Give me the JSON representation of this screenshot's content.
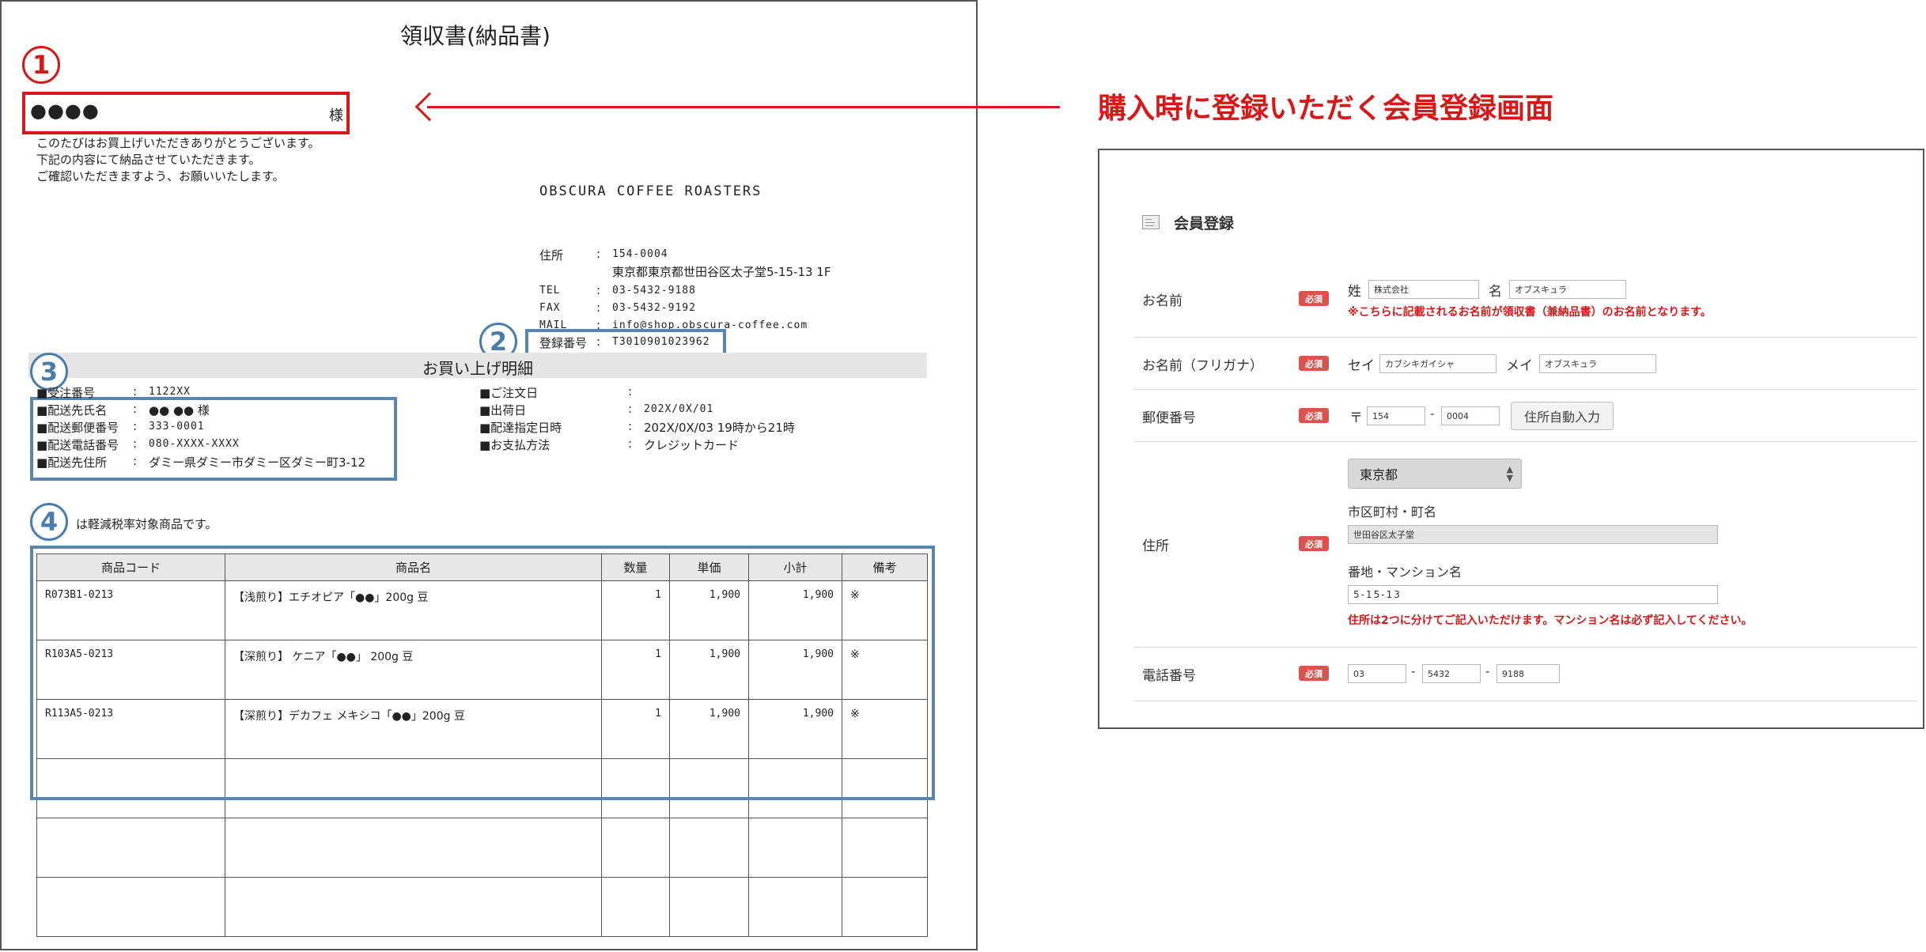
{
  "receipt": {
    "title": "領収書(納品書)",
    "badge1": "1",
    "badge2": "2",
    "badge3": "3",
    "badge4": "4",
    "recipient_name": "●●●●",
    "recipient_suffix": "様",
    "greeting": [
      "このたびはお買上げいただきありがとうございます。",
      "下記の内容にて納品させていただきます。",
      "ご確認いただきますよう、お願いいたします。"
    ],
    "shop_name": "OBSCURA COFFEE ROASTERS",
    "shop_info": [
      {
        "label": "住所",
        "sep": ":",
        "value": "154-0004"
      },
      {
        "label": "",
        "sep": "",
        "value": "東京都東京都世田谷区太子堂5-15-13 1F"
      },
      {
        "label": "TEL",
        "sep": ":",
        "value": "03-5432-9188"
      },
      {
        "label": "FAX",
        "sep": ":",
        "value": "03-5432-9192"
      },
      {
        "label": "MAIL",
        "sep": ":",
        "value": "info@shop.obscura-coffee.com"
      }
    ],
    "registration": {
      "label": "登録番号",
      "sep": ":",
      "value": "T3010901023962"
    },
    "section_title": "お買い上げ明細",
    "order_left": [
      {
        "label": "■受注番号",
        "sep": ":",
        "value": "1122XX"
      },
      {
        "label": "■配送先氏名",
        "sep": ":",
        "value": "●● ●● 様"
      },
      {
        "label": "■配送郵便番号",
        "sep": ":",
        "value": "333-0001"
      },
      {
        "label": "■配送電話番号",
        "sep": ":",
        "value": "080-XXXX-XXXX"
      },
      {
        "label": "■配送先住所",
        "sep": ":",
        "value": "ダミー県ダミー市ダミー区ダミー町3-12"
      }
    ],
    "order_right": [
      {
        "label": "■ご注文日",
        "sep": ":",
        "value": ""
      },
      {
        "label": "■出荷日",
        "sep": ":",
        "value": "202X/0X/01"
      },
      {
        "label": "■配達指定日時",
        "sep": ":",
        "value": "202X/0X/03 19時から21時"
      },
      {
        "label": "■お支払方法",
        "sep": ":",
        "value": "クレジットカード"
      }
    ],
    "reduced_tax_note": "は軽減税率対象商品です。",
    "table": {
      "headers": [
        "商品コード",
        "商品名",
        "数量",
        "単価",
        "小計",
        "備考"
      ],
      "rows": [
        [
          "R073B1-0213",
          "【浅煎り】エチオピア「●●」200g 豆",
          "1",
          "1,900",
          "1,900",
          "※"
        ],
        [
          "R103A5-0213",
          "【深煎り】 ケニア「●●」 200g 豆",
          "1",
          "1,900",
          "1,900",
          "※"
        ],
        [
          "R113A5-0213",
          "【深煎り】デカフェ メキシコ「●●」200g 豆",
          "1",
          "1,900",
          "1,900",
          "※"
        ],
        [
          "",
          "",
          "",
          "",
          "",
          ""
        ],
        [
          "",
          "",
          "",
          "",
          "",
          ""
        ],
        [
          "",
          "",
          "",
          "",
          "",
          ""
        ]
      ]
    }
  },
  "heading": "購入時に登録いただく会員登録画面",
  "form": {
    "title": "会員登録",
    "required": "必須",
    "name": {
      "label": "お名前",
      "sei_label": "姓",
      "sei_value": "株式会社",
      "mei_label": "名",
      "mei_value": "オブスキュラ",
      "note": "※こちらに記載されるお名前が領収書（兼納品書）のお名前となります。"
    },
    "kana": {
      "label": "お名前（フリガナ）",
      "sei_label": "セイ",
      "sei_value": "カブシキガイシャ",
      "mei_label": "メイ",
      "mei_value": "オブスキュラ"
    },
    "postal": {
      "label": "郵便番号",
      "mark": "〒",
      "part1": "154",
      "dash": "-",
      "part2": "0004",
      "button": "住所自動入力"
    },
    "address": {
      "label": "住所",
      "prefecture": "東京都",
      "city_label": "市区町村・町名",
      "city_value": "世田谷区太子堂",
      "street_label": "番地・マンション名",
      "street_value": "5-15-13",
      "note": "住所は2つに分けてご記入いただけます。マンション名は必ず記入してください。"
    },
    "phone": {
      "label": "電話番号",
      "p1": "03",
      "dash": "-",
      "p2": "5432",
      "p3": "9188"
    }
  }
}
